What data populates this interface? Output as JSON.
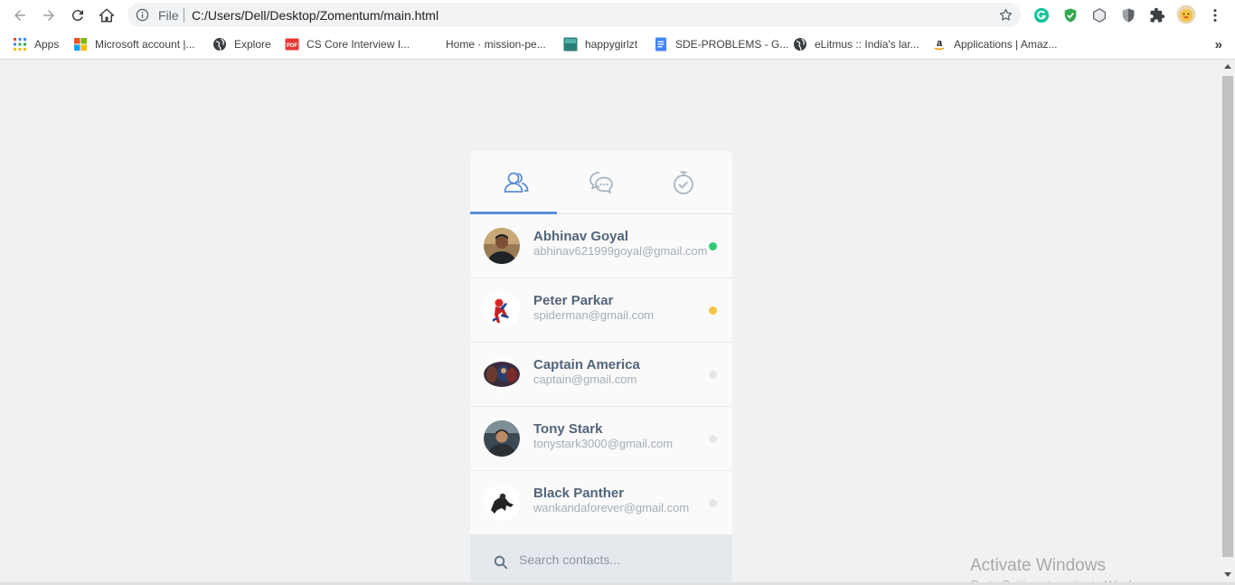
{
  "browser": {
    "scheme_label": "File",
    "url": "C:/Users/Dell/Desktop/Zomentum/main.html"
  },
  "bookmarks": [
    {
      "label": "Apps",
      "icon": "apps-grid-icon"
    },
    {
      "label": "Microsoft account |...",
      "icon": "microsoft-logo-icon"
    },
    {
      "label": "Explore",
      "icon": "globe-icon"
    },
    {
      "label": "CS Core Interview I...",
      "icon": "pdf-icon"
    },
    {
      "label": "Home · mission-pe...",
      "icon": "github-icon"
    },
    {
      "label": "happygirlzt",
      "icon": "teal-site-icon"
    },
    {
      "label": "SDE-PROBLEMS - G...",
      "icon": "google-docs-icon"
    },
    {
      "label": "eLitmus :: India's lar...",
      "icon": "globe-icon"
    },
    {
      "label": "Applications | Amaz...",
      "icon": "amazon-icon"
    }
  ],
  "bookmarks_more": "»",
  "tabs": [
    {
      "name": "contacts",
      "icon": "users-icon",
      "active": true
    },
    {
      "name": "chats",
      "icon": "chat-bubbles-icon",
      "active": false
    },
    {
      "name": "history",
      "icon": "stopwatch-icon",
      "active": false
    }
  ],
  "contacts": [
    {
      "name": "Abhinav Goyal",
      "email": "abhinav621999goyal@gmail.com",
      "status": "online",
      "status_color": "#2ecc71"
    },
    {
      "name": "Peter Parkar",
      "email": "spiderman@gmail.com",
      "status": "away",
      "status_color": "#f5c542"
    },
    {
      "name": "Captain America",
      "email": "captain@gmail.com",
      "status": "offline",
      "status_color": "#e4e7ea"
    },
    {
      "name": "Tony Stark",
      "email": "tonystark3000@gmail.com",
      "status": "offline",
      "status_color": "#e4e7ea"
    },
    {
      "name": "Black Panther",
      "email": "wankandaforever@gmail.com",
      "status": "offline",
      "status_color": "#e4e7ea"
    }
  ],
  "search": {
    "placeholder": "Search contacts..."
  },
  "watermark": {
    "title": "Activate Windows",
    "subtitle": "Go to Settings to activate Windows."
  },
  "colors": {
    "accent": "#5b8fd4",
    "name_text": "#52657a",
    "email_text": "#a5adb5"
  }
}
